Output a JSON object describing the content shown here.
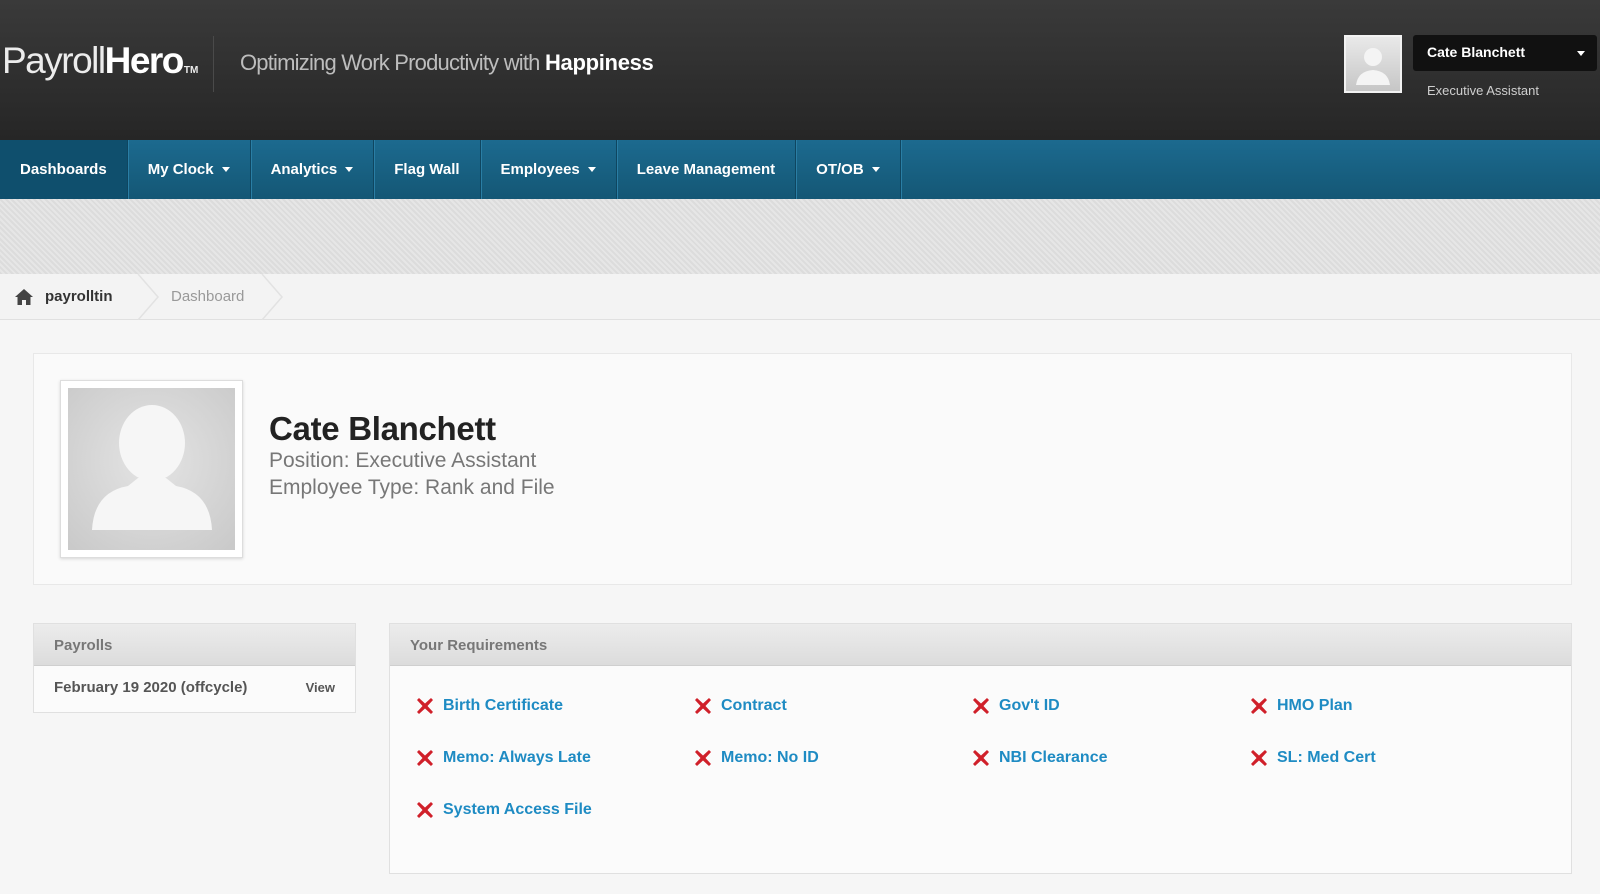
{
  "header": {
    "logo_light": "Payroll",
    "logo_bold": "Hero",
    "logo_tm": "TM",
    "tagline_light": "Optimizing Work Productivity with",
    "tagline_bold": "Happiness",
    "user_name": "Cate Blanchett",
    "user_role": "Executive Assistant"
  },
  "nav": {
    "items": [
      {
        "label": "Dashboards",
        "dropdown": false
      },
      {
        "label": "My Clock",
        "dropdown": true
      },
      {
        "label": "Analytics",
        "dropdown": true
      },
      {
        "label": "Flag Wall",
        "dropdown": false
      },
      {
        "label": "Employees",
        "dropdown": true
      },
      {
        "label": "Leave Management",
        "dropdown": false
      },
      {
        "label": "OT/OB",
        "dropdown": true
      }
    ]
  },
  "breadcrumb": {
    "home": "payrolltin",
    "current": "Dashboard"
  },
  "profile": {
    "name": "Cate Blanchett",
    "position": "Position: Executive Assistant",
    "employee_type": "Employee Type: Rank and File"
  },
  "payrolls": {
    "title": "Payrolls",
    "rows": [
      {
        "label": "February 19 2020 (offcycle)",
        "action": "View"
      }
    ]
  },
  "requirements": {
    "title": "Your Requirements",
    "items": [
      "Birth Certificate",
      "Contract",
      "Gov't ID",
      "HMO Plan",
      "Memo: Always Late",
      "Memo: No ID",
      "NBI Clearance",
      "SL: Med Cert",
      "System Access File"
    ],
    "status_icon": "x-mark-icon",
    "status_color": "#d0202a",
    "link_color": "#1e8bc3"
  },
  "colors": {
    "nav_bg": "#1a6588",
    "header_bg": "#2e2e2e"
  }
}
